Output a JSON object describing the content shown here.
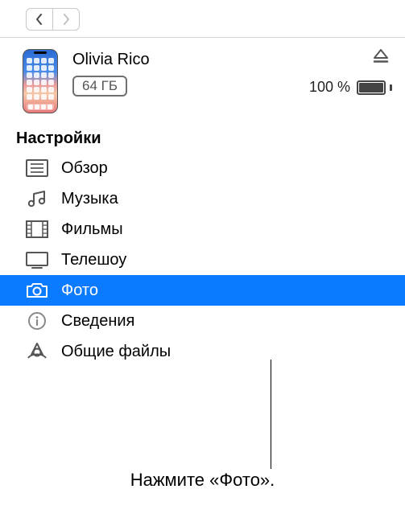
{
  "nav": {
    "back": "Назад",
    "forward": "Вперёд"
  },
  "device": {
    "name": "Olivia Rico",
    "capacity": "64 ГБ",
    "battery_percent": "100 %",
    "eject": "Извлечь"
  },
  "section_title": "Настройки",
  "menu": [
    {
      "id": "summary",
      "label": "Обзор",
      "selected": false
    },
    {
      "id": "music",
      "label": "Музыка",
      "selected": false
    },
    {
      "id": "movies",
      "label": "Фильмы",
      "selected": false
    },
    {
      "id": "tvshows",
      "label": "Телешоу",
      "selected": false
    },
    {
      "id": "photos",
      "label": "Фото",
      "selected": true
    },
    {
      "id": "info",
      "label": "Сведения",
      "selected": false
    },
    {
      "id": "files",
      "label": "Общие файлы",
      "selected": false
    }
  ],
  "callout": "Нажмите «Фото»."
}
